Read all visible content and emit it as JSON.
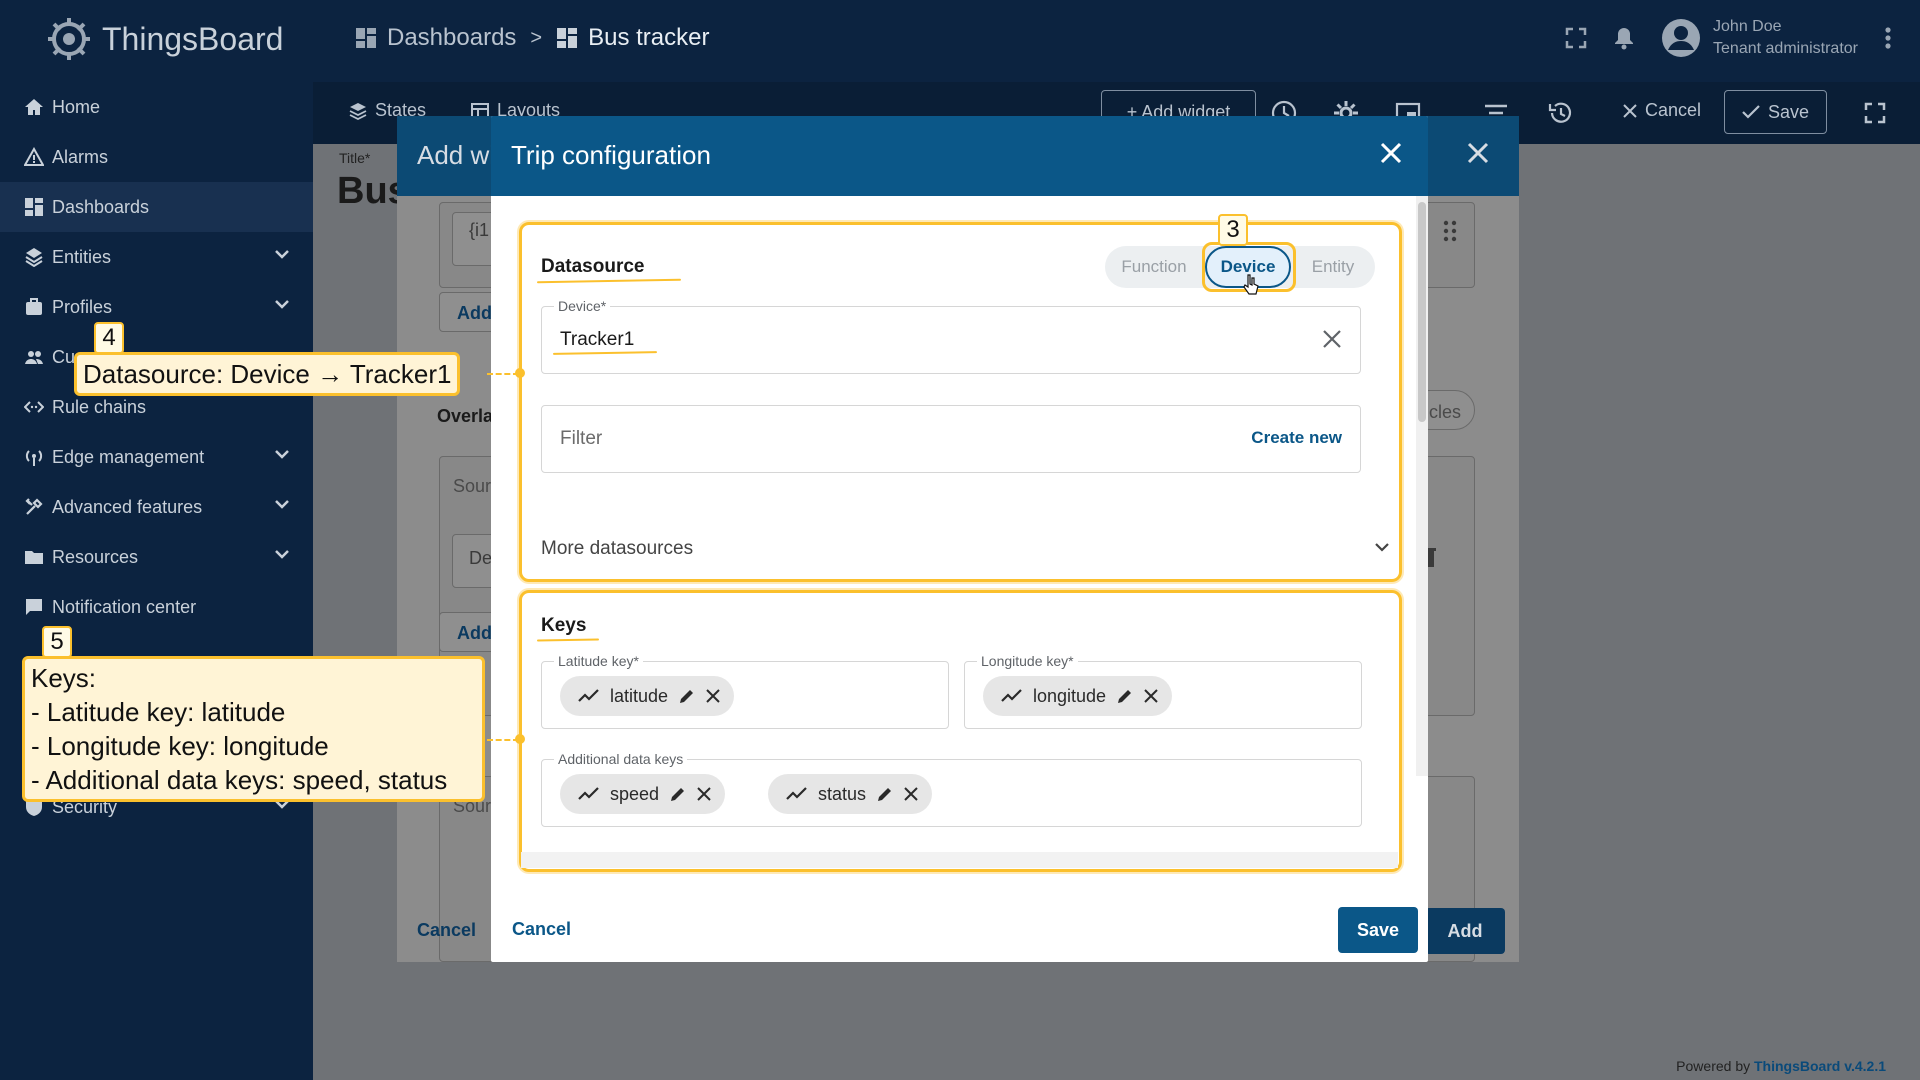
{
  "app": {
    "name": "ThingsBoard",
    "breadcrumb": [
      {
        "label": "Dashboards"
      },
      {
        "label": "Bus tracker"
      }
    ],
    "breadcrumb_sep": ">",
    "user": {
      "name": "John Doe",
      "role": "Tenant administrator"
    },
    "powered_prefix": "Powered by",
    "powered_brand": "ThingsBoard v.4.2.1"
  },
  "sidebar": {
    "items": [
      {
        "label": "Home",
        "icon": "home-icon",
        "expandable": false
      },
      {
        "label": "Alarms",
        "icon": "alarm-icon",
        "expandable": false
      },
      {
        "label": "Dashboards",
        "icon": "dashboard-icon",
        "expandable": false,
        "active": true
      },
      {
        "label": "Entities",
        "icon": "entities-icon",
        "expandable": true
      },
      {
        "label": "Profiles",
        "icon": "profiles-icon",
        "expandable": true
      },
      {
        "label": "Cu",
        "icon": "customers-icon",
        "expandable": false
      },
      {
        "label": "Rule chains",
        "icon": "rule-chains-icon",
        "expandable": false
      },
      {
        "label": "Edge management",
        "icon": "edge-icon",
        "expandable": true
      },
      {
        "label": "Advanced features",
        "icon": "tools-icon",
        "expandable": true
      },
      {
        "label": "Resources",
        "icon": "folder-icon",
        "expandable": true
      },
      {
        "label": "Notification center",
        "icon": "notification-icon",
        "expandable": false
      },
      {
        "label": "Security",
        "icon": "shield-icon",
        "expandable": true
      }
    ]
  },
  "dashboard_toolbar": {
    "states": "States",
    "layouts": "Layouts",
    "add_widget": "+ Add widget",
    "cancel": "Cancel",
    "save": "Save"
  },
  "add_widget_dialog": {
    "title": "Add wi",
    "field_title_label": "Title*",
    "big_title": "Bus",
    "input_text": "{i1",
    "add_link_1": "Add",
    "overlay_label": "Overla",
    "source_text_1": "Sour",
    "de_text": "De",
    "add_link_2": "Add",
    "source_text_2": "Sour",
    "cles_text": "cles",
    "cancel": "Cancel",
    "add": "Add"
  },
  "trip_dialog": {
    "title": "Trip configuration",
    "datasource": {
      "title": "Datasource",
      "type_options": [
        "Function",
        "Device",
        "Entity"
      ],
      "selected_type": "Device",
      "device_label": "Device*",
      "device_value": "Tracker1",
      "filter_placeholder": "Filter",
      "create_new": "Create new",
      "more_datasources": "More datasources"
    },
    "keys": {
      "title": "Keys",
      "latitude_label": "Latitude key*",
      "latitude_chip": "latitude",
      "longitude_label": "Longitude key*",
      "longitude_chip": "longitude",
      "additional_label": "Additional data keys",
      "additional_chips": [
        "speed",
        "status"
      ]
    },
    "cancel": "Cancel",
    "save": "Save"
  },
  "annotations": {
    "step3": "3",
    "step4": "4",
    "step4_text": "Datasource: Device → Tracker1",
    "step5": "5",
    "step5_lines": [
      "Keys:",
      "- Latitude key: latitude",
      "- Longitude key: longitude",
      "- Additional data keys: speed, status"
    ]
  },
  "colors": {
    "navy": "#0c2340",
    "header_blue": "#0b5788",
    "highlight": "#fbc02d",
    "callout_bg": "#fff4d6"
  }
}
